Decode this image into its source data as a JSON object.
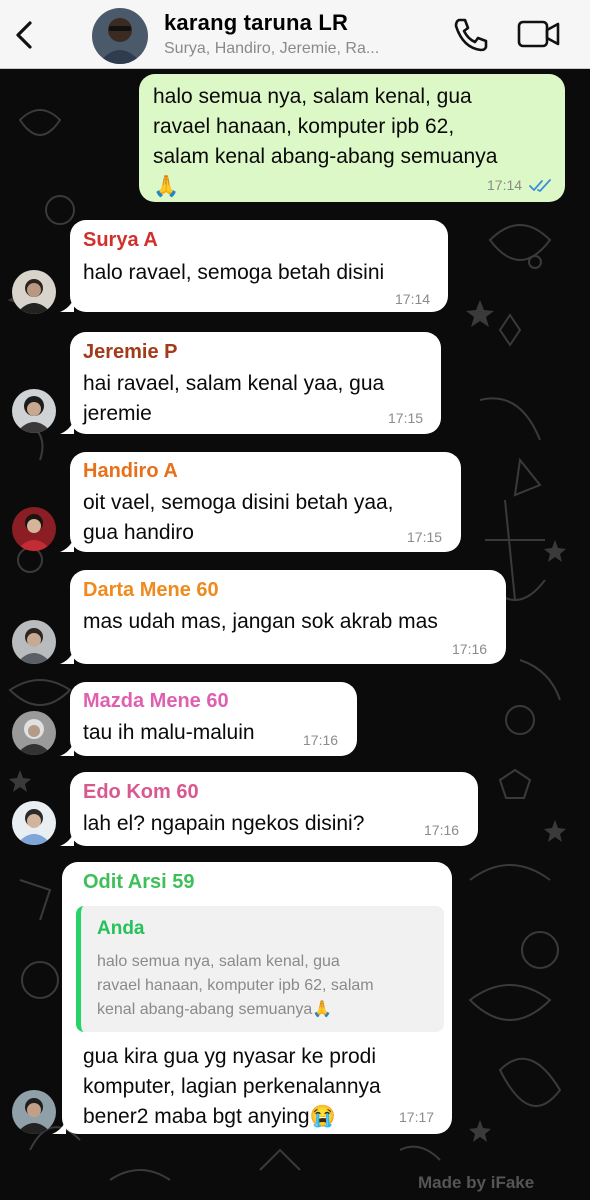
{
  "header": {
    "back_icon": "chevron-left-icon",
    "title": "karang taruna LR",
    "subtitle": "Surya, Handiro, Jeremie, Ra...",
    "call_icon": "phone-icon",
    "video_icon": "video-camera-icon"
  },
  "messages": [
    {
      "sender": "",
      "text": "halo semua nya, salam kenal, gua\nravael hanaan, komputer ipb 62,\nsalam kenal abang-abang semuanya\n🙏",
      "time": "17:14",
      "status": "read"
    },
    {
      "sender": "Surya A",
      "color": "#d0312d",
      "text": "halo ravael, semoga betah disini",
      "time": "17:14"
    },
    {
      "sender": "Jeremie P",
      "color": "#a23a1b",
      "text": "hai ravael, salam kenal yaa, gua\njeremie",
      "time": "17:15"
    },
    {
      "sender": "Handiro A",
      "color": "#e8701a",
      "text": "oit vael, semoga disini betah yaa,\ngua handiro",
      "time": "17:15"
    },
    {
      "sender": "Darta Mene 60",
      "color": "#f08a1c",
      "text": "mas udah mas, jangan sok akrab mas",
      "time": "17:16"
    },
    {
      "sender": "Mazda Mene 60",
      "color": "#e05fb0",
      "text": "tau ih malu-maluin",
      "time": "17:16"
    },
    {
      "sender": "Edo Kom 60",
      "color": "#d8588f",
      "text": "lah el? ngapain ngekos disini?",
      "time": "17:16"
    },
    {
      "sender": "Odit Arsi 59",
      "color": "#3fbf58",
      "quote_sender": "Anda",
      "quote_text": "halo semua nya, salam kenal, gua\nravael hanaan, komputer ipb 62, salam\nkenal abang-abang semuanya🙏",
      "text": "gua kira gua yg nyasar ke prodi\nkomputer, lagian perkenalannya\nbener2 maba bgt anying😭",
      "time": "17:17"
    }
  ],
  "watermark": "Made by iFake"
}
